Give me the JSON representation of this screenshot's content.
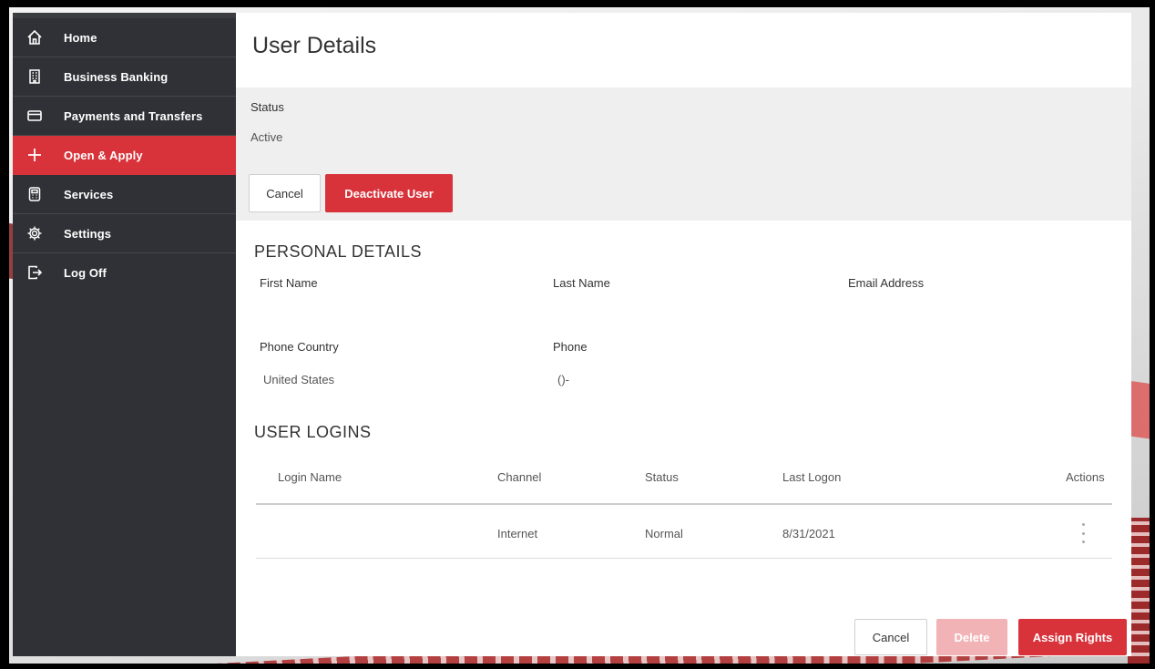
{
  "sidebar": {
    "items": [
      {
        "label": "Home",
        "icon": "home-icon"
      },
      {
        "label": "Business Banking",
        "icon": "building-icon"
      },
      {
        "label": "Payments and Transfers",
        "icon": "card-icon"
      },
      {
        "label": "Open & Apply",
        "icon": "plus-icon"
      },
      {
        "label": "Services",
        "icon": "calculator-icon"
      },
      {
        "label": "Settings",
        "icon": "gear-icon"
      },
      {
        "label": "Log Off",
        "icon": "logout-icon"
      }
    ],
    "active_item": "Open & Apply"
  },
  "page": {
    "title": "User Details"
  },
  "status_panel": {
    "label": "Status",
    "value": "Active",
    "cancel_label": "Cancel",
    "deactivate_label": "Deactivate User"
  },
  "personal_details": {
    "heading": "PERSONAL DETAILS",
    "first_name_label": "First Name",
    "last_name_label": "Last Name",
    "email_label": "Email Address",
    "phone_country_label": "Phone Country",
    "phone_country_value": "United States",
    "phone_label": "Phone",
    "phone_value": "()-"
  },
  "user_logins": {
    "heading": "USER LOGINS",
    "columns": [
      "Login Name",
      "Channel",
      "Status",
      "Last Logon",
      "Actions"
    ],
    "rows": [
      {
        "login_name": "",
        "channel": "Internet",
        "status": "Normal",
        "last_logon": "8/31/2021"
      }
    ]
  },
  "footer": {
    "cancel_label": "Cancel",
    "delete_label": "Delete",
    "assign_rights_label": "Assign Rights"
  },
  "colors": {
    "accent": "#d8323a",
    "sidebar_bg": "#2f3136",
    "disabled_accent": "#f2b3b6"
  }
}
